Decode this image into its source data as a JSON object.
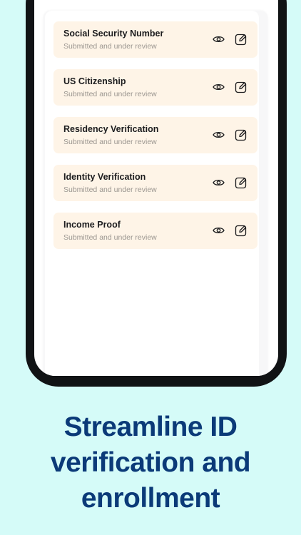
{
  "documents": [
    {
      "title": "Social Security Number",
      "status": "Submitted and under review"
    },
    {
      "title": "US Citizenship",
      "status": "Submitted and under review"
    },
    {
      "title": "Residency Verification",
      "status": "Submitted and under review"
    },
    {
      "title": "Identity Verification",
      "status": "Submitted and under review"
    },
    {
      "title": "Income Proof",
      "status": "Submitted and under review"
    }
  ],
  "icons": {
    "view": "eye-icon",
    "edit": "edit-icon"
  },
  "headline": {
    "line1": "Streamline ID",
    "line2": "verification and",
    "line3": "enrollment"
  },
  "colors": {
    "background": "#d5fbf8",
    "card": "#fef4e7",
    "headline": "#0b3a78"
  }
}
